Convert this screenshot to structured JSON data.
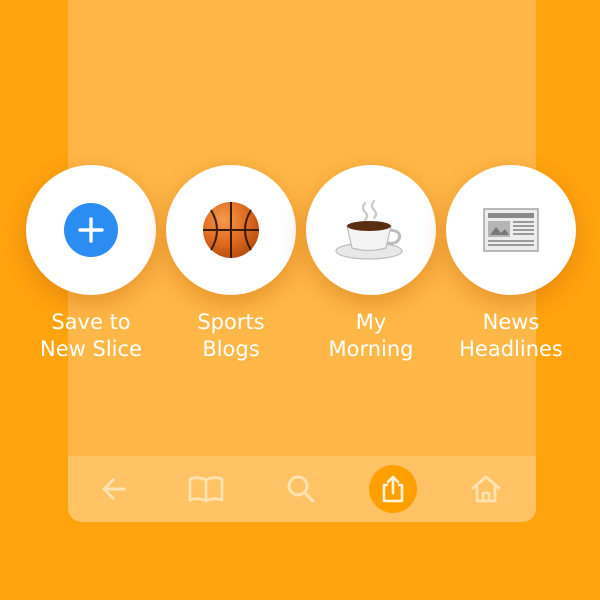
{
  "slices": [
    {
      "id": "new",
      "icon": "plus-icon",
      "line1": "Save to",
      "line2": "New Slice",
      "accent": "#2B8CF2"
    },
    {
      "id": "sports",
      "icon": "basketball-icon",
      "line1": "Sports",
      "line2": "Blogs"
    },
    {
      "id": "morning",
      "icon": "coffee-cup-icon",
      "line1": "My",
      "line2": "Morning"
    },
    {
      "id": "news",
      "icon": "newspaper-icon",
      "line1": "News",
      "line2": "Headlines"
    }
  ],
  "toolbar": {
    "items": [
      {
        "icon": "back-arrow-icon",
        "active": false
      },
      {
        "icon": "book-icon",
        "active": false
      },
      {
        "icon": "search-icon",
        "active": false
      },
      {
        "icon": "share-icon",
        "active": true
      },
      {
        "icon": "home-icon",
        "active": false
      }
    ]
  },
  "colors": {
    "background": "#FFA40F",
    "panel": "#FFB847",
    "toolbar": "#FFC264",
    "toolbar_icon": "#FFE3B3",
    "active_tool": "#FFA000",
    "label_text": "#FFFFFF"
  }
}
